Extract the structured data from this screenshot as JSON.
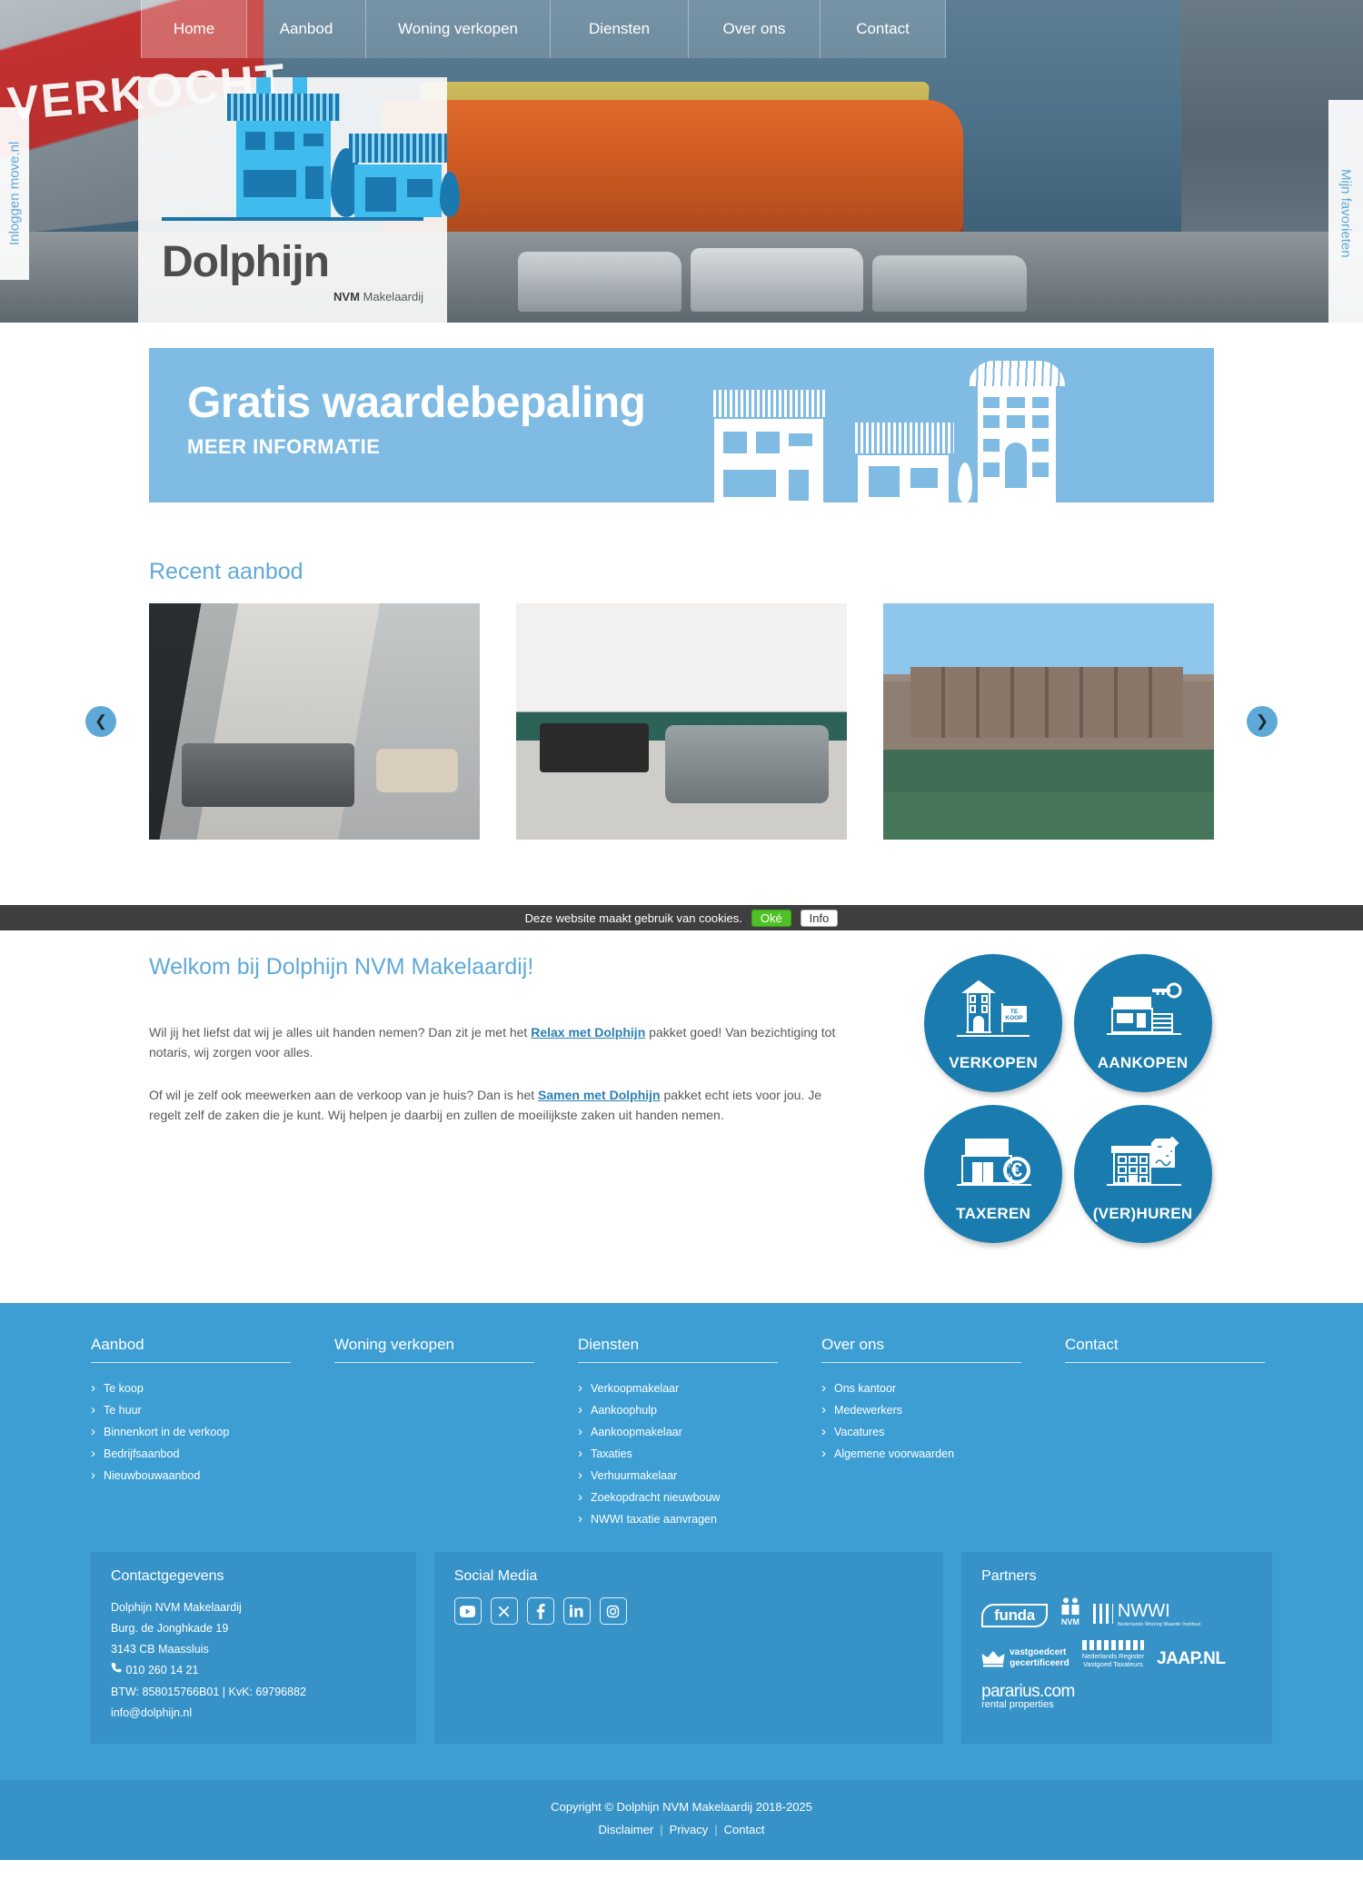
{
  "nav": {
    "items": [
      {
        "label": "Home",
        "active": true
      },
      {
        "label": "Aanbod",
        "active": false
      },
      {
        "label": "Woning verkopen",
        "active": false
      },
      {
        "label": "Diensten",
        "active": false
      },
      {
        "label": "Over ons",
        "active": false
      },
      {
        "label": "Contact",
        "active": false
      }
    ]
  },
  "logo": {
    "word": "Dolphijn",
    "sub_bold": "NVM",
    "sub_rest": " Makelaardij",
    "icon": "houses-logo-icon"
  },
  "hero": {
    "sign_text": "VERKOCHT",
    "left_tab": "Inloggen move.nl",
    "right_tab": "Mijn favorieten"
  },
  "banner": {
    "title": "Gratis waardebepaling",
    "subtitle": "MEER INFORMATIE",
    "bg_color": "#7fbbe3"
  },
  "recent": {
    "title": "Recent aanbod",
    "prev_icon": "chevron-left-icon",
    "next_icon": "chevron-right-icon",
    "cards": [
      {
        "alt": "woonkamer-met-bank-en-schuifpui"
      },
      {
        "alt": "woonkamer-met-tv-en-hoekbank"
      },
      {
        "alt": "grachtpanden-aan-het-water"
      }
    ]
  },
  "cookie": {
    "message": "Deze website maakt gebruik van cookies.",
    "accept_label": "Oké",
    "info_label": "Info",
    "accept_color": "#4dc126",
    "bar_color": "#3f3f3f"
  },
  "welcome": {
    "title": "Welkom bij Dolphijn NVM Makelaardij!",
    "p1_before": "Wil jij het liefst dat wij je alles uit handen nemen? Dan zit je met het ",
    "p1_link": "Relax met Dolphijn",
    "p1_after": " pakket goed! Van bezichtiging tot notaris, wij zorgen voor alles.",
    "p2_before": "Of wil je zelf ook meewerken aan de verkoop van je huis? Dan is het ",
    "p2_link": "Samen met Dolphijn",
    "p2_after": " pakket echt iets voor jou. Je regelt zelf de zaken die je kunt. Wij helpen je daarbij en zullen de moeilijkste zaken uit handen nemen."
  },
  "badges": [
    {
      "label": "VERKOPEN",
      "icon": "house-for-sale-icon"
    },
    {
      "label": "AANKOPEN",
      "icon": "house-with-key-icon"
    },
    {
      "label": "TAXEREN",
      "icon": "house-with-euro-icon"
    },
    {
      "label": "(VER)HUREN",
      "icon": "building-with-contract-icon"
    }
  ],
  "footer": {
    "bg_color": "#3d9ed4",
    "columns": [
      {
        "title": "Aanbod",
        "links": [
          "Te koop",
          "Te huur",
          "Binnenkort in de verkoop",
          "Bedrijfsaanbod",
          "Nieuwbouwaanbod"
        ]
      },
      {
        "title": "Woning verkopen",
        "links": []
      },
      {
        "title": "Diensten",
        "links": [
          "Verkoopmakelaar",
          "Aankoophulp",
          "Aankoopmakelaar",
          "Taxaties",
          "Verhuurmakelaar",
          "Zoekopdracht nieuwbouw",
          "NWWI taxatie aanvragen"
        ]
      },
      {
        "title": "Over ons",
        "links": [
          "Ons kantoor",
          "Medewerkers",
          "Vacatures",
          "Algemene voorwaarden"
        ]
      },
      {
        "title": "Contact",
        "links": []
      }
    ],
    "contact": {
      "title": "Contactgegevens",
      "company": "Dolphijn NVM Makelaardij",
      "street": "Burg. de Jonghkade 19",
      "city": "3143 CB Maassluis",
      "phone_icon": "phone-icon",
      "phone": "010 260 14 21",
      "tax": "BTW: 858015766B01 | KvK: 69796882",
      "email": "info@dolphijn.nl"
    },
    "social": {
      "title": "Social Media",
      "icons": [
        {
          "name": "youtube-icon",
          "glyph": "▶"
        },
        {
          "name": "x-twitter-icon",
          "glyph": "✕"
        },
        {
          "name": "facebook-icon",
          "glyph": "f"
        },
        {
          "name": "linkedin-icon",
          "glyph": "in"
        },
        {
          "name": "instagram-icon",
          "glyph": "◎"
        }
      ]
    },
    "partners": {
      "title": "Partners",
      "items": [
        {
          "name": "funda",
          "type": "funda"
        },
        {
          "name": "NVM",
          "type": "nvm"
        },
        {
          "name": "NWWI",
          "type": "nwwi",
          "tagline": "Nederlands Woning Waarde Instituut"
        },
        {
          "name": "vastgoedcert gecertificeerd",
          "type": "vgc",
          "line1": "vastgoedcert",
          "line2": "gecertificeerd"
        },
        {
          "name": "Nederlands Register Vastgoed Taxateurs",
          "type": "nrvt",
          "line1": "Nederlands Register",
          "line2": "Vastgoed Taxateurs"
        },
        {
          "name": "JAAP.NL",
          "type": "jaap"
        },
        {
          "name": "pararius.com rental properties",
          "type": "pararius",
          "line1": "pararius.com",
          "line2": "rental properties"
        }
      ]
    }
  },
  "copyright": {
    "text": "Copyright © Dolphijn NVM Makelaardij 2018-2025",
    "links": [
      "Disclaimer",
      "Privacy",
      "Contact"
    ]
  }
}
